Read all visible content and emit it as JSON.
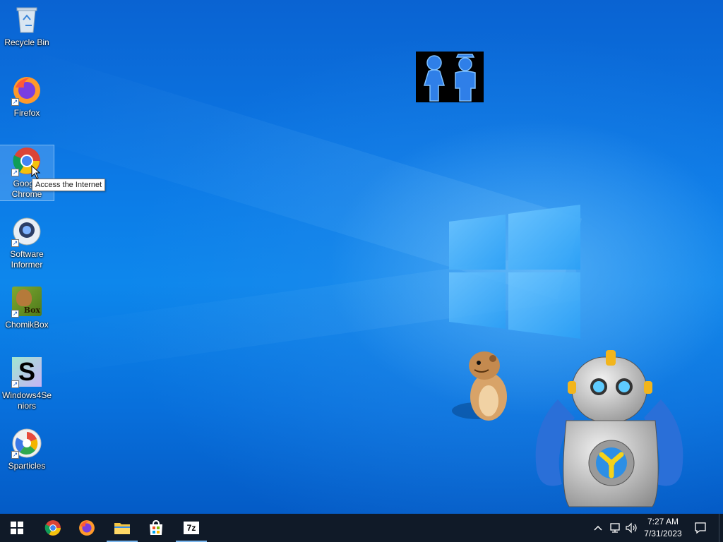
{
  "desktop": {
    "icons": [
      {
        "label": "Recycle Bin",
        "icon": "recycle-bin-icon"
      },
      {
        "label": "Firefox",
        "icon": "firefox-icon"
      },
      {
        "label": "Google Chrome",
        "icon": "chrome-icon",
        "selected": true
      },
      {
        "label": "Software Informer",
        "icon": "software-informer-icon"
      },
      {
        "label": "ChomikBox",
        "icon": "chomikbox-icon"
      },
      {
        "label": "Windows4Seniors",
        "icon": "windows4seniors-icon"
      },
      {
        "label": "Sparticles",
        "icon": "sparticles-icon"
      }
    ],
    "tooltip": "Access the Internet",
    "chomik_badge": "Box",
    "w4s_letter": "S"
  },
  "taskbar": {
    "pinned": [
      {
        "name": "start-button",
        "icon": "windows-logo-icon"
      },
      {
        "name": "chrome",
        "icon": "chrome-icon"
      },
      {
        "name": "firefox",
        "icon": "firefox-icon"
      },
      {
        "name": "file-explorer",
        "icon": "folder-icon",
        "active": true
      },
      {
        "name": "microsoft-store",
        "icon": "store-icon"
      },
      {
        "name": "7-zip",
        "icon": "7zip-icon",
        "active": true,
        "label": "7z"
      }
    ],
    "clock": {
      "time": "7:27 AM",
      "date": "7/31/2023"
    }
  },
  "colors": {
    "taskbar": "#101a28",
    "accent": "#7ab7ef",
    "wallpaper": "#0c7ae6"
  }
}
